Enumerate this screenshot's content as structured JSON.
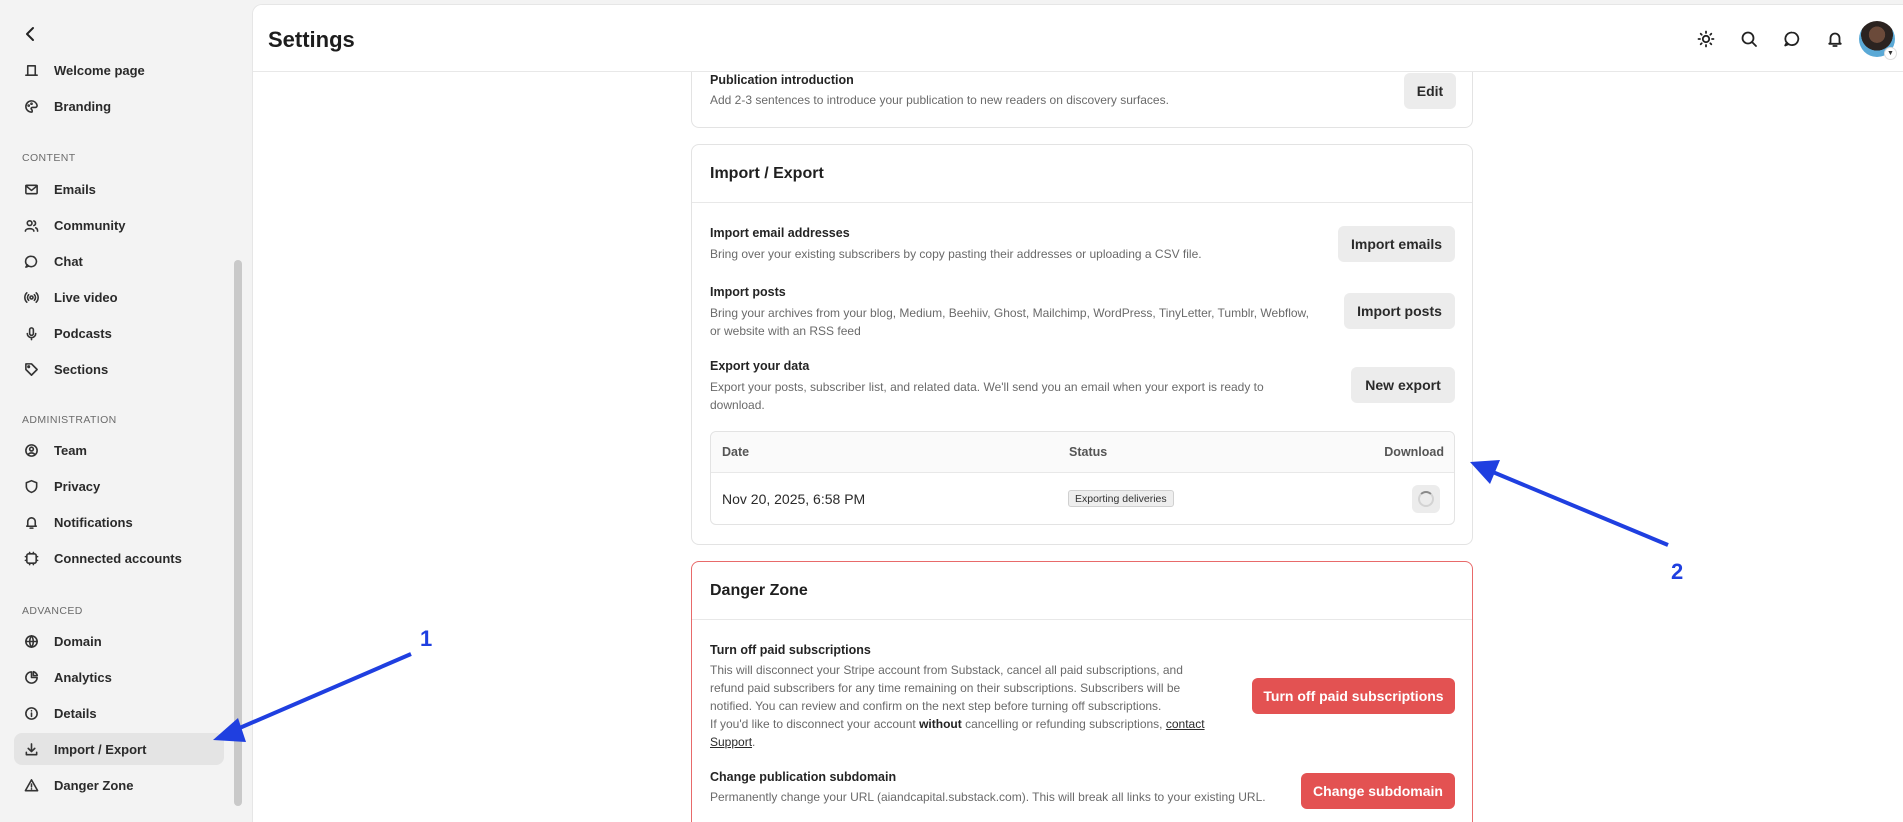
{
  "sidebar": {
    "items_top": [
      {
        "label": "Welcome page",
        "icon": "welcome-icon"
      },
      {
        "label": "Branding",
        "icon": "palette-icon"
      }
    ],
    "content_label": "CONTENT",
    "content_items": [
      {
        "label": "Emails",
        "icon": "mail-icon"
      },
      {
        "label": "Community",
        "icon": "people-icon"
      },
      {
        "label": "Chat",
        "icon": "chat-icon"
      },
      {
        "label": "Live video",
        "icon": "broadcast-icon"
      },
      {
        "label": "Podcasts",
        "icon": "microphone-icon"
      },
      {
        "label": "Sections",
        "icon": "tag-icon"
      }
    ],
    "admin_label": "ADMINISTRATION",
    "admin_items": [
      {
        "label": "Team",
        "icon": "user-circle-icon"
      },
      {
        "label": "Privacy",
        "icon": "shield-icon"
      },
      {
        "label": "Notifications",
        "icon": "bell-icon"
      },
      {
        "label": "Connected accounts",
        "icon": "connected-icon"
      }
    ],
    "advanced_label": "ADVANCED",
    "advanced_items": [
      {
        "label": "Domain",
        "icon": "globe-icon"
      },
      {
        "label": "Analytics",
        "icon": "analytics-icon"
      },
      {
        "label": "Details",
        "icon": "info-icon"
      },
      {
        "label": "Import / Export",
        "icon": "download-icon",
        "active": true
      },
      {
        "label": "Danger Zone",
        "icon": "warning-icon"
      }
    ]
  },
  "header": {
    "title": "Settings"
  },
  "intro": {
    "title": "Publication introduction",
    "desc": "Add 2-3 sentences to introduce your publication to new readers on discovery surfaces.",
    "button": "Edit"
  },
  "import_export": {
    "title": "Import / Export",
    "rows": [
      {
        "title": "Import email addresses",
        "desc": "Bring over your existing subscribers by copy pasting their addresses or uploading a CSV file.",
        "button": "Import emails"
      },
      {
        "title": "Import posts",
        "desc1": "Bring your archives from your blog, Medium, Beehiiv, Ghost, Mailchimp, WordPress, TinyLetter, Tumblr, Webflow,",
        "desc2": "or website with an RSS feed",
        "button": "Import posts"
      },
      {
        "title": "Export your data",
        "desc1": "Export your posts, subscriber list, and related data. We'll send you an email when your export is ready to",
        "desc2": "download.",
        "button": "New export"
      }
    ],
    "table": {
      "headers": {
        "date": "Date",
        "status": "Status",
        "download": "Download"
      },
      "rows": [
        {
          "date": "Nov 20, 2025, 6:58 PM",
          "status": "Exporting deliveries"
        }
      ]
    }
  },
  "danger_zone": {
    "title": "Danger Zone",
    "paid": {
      "title": "Turn off paid subscriptions",
      "line1": "This will disconnect your Stripe account from Substack, cancel all paid subscriptions, and",
      "line2": "refund paid subscribers for any time remaining on their subscriptions. Subscribers will be",
      "line3": "notified. You can review and confirm on the next step before turning off subscriptions.",
      "line4_pre": "If you'd like to disconnect your account ",
      "line4_bold": "without",
      "line4_post": " cancelling or refunding subscriptions, ",
      "link1": "contact",
      "link2": "Support",
      "period": ".",
      "button": "Turn off paid subscriptions"
    },
    "subdomain": {
      "title": "Change publication subdomain",
      "desc": "Permanently change your URL (aiandcapital.substack.com). This will break all links to your existing URL.",
      "button": "Change subdomain"
    }
  },
  "annotations": {
    "one": "1",
    "two": "2",
    "color": "#1f3fe0"
  }
}
